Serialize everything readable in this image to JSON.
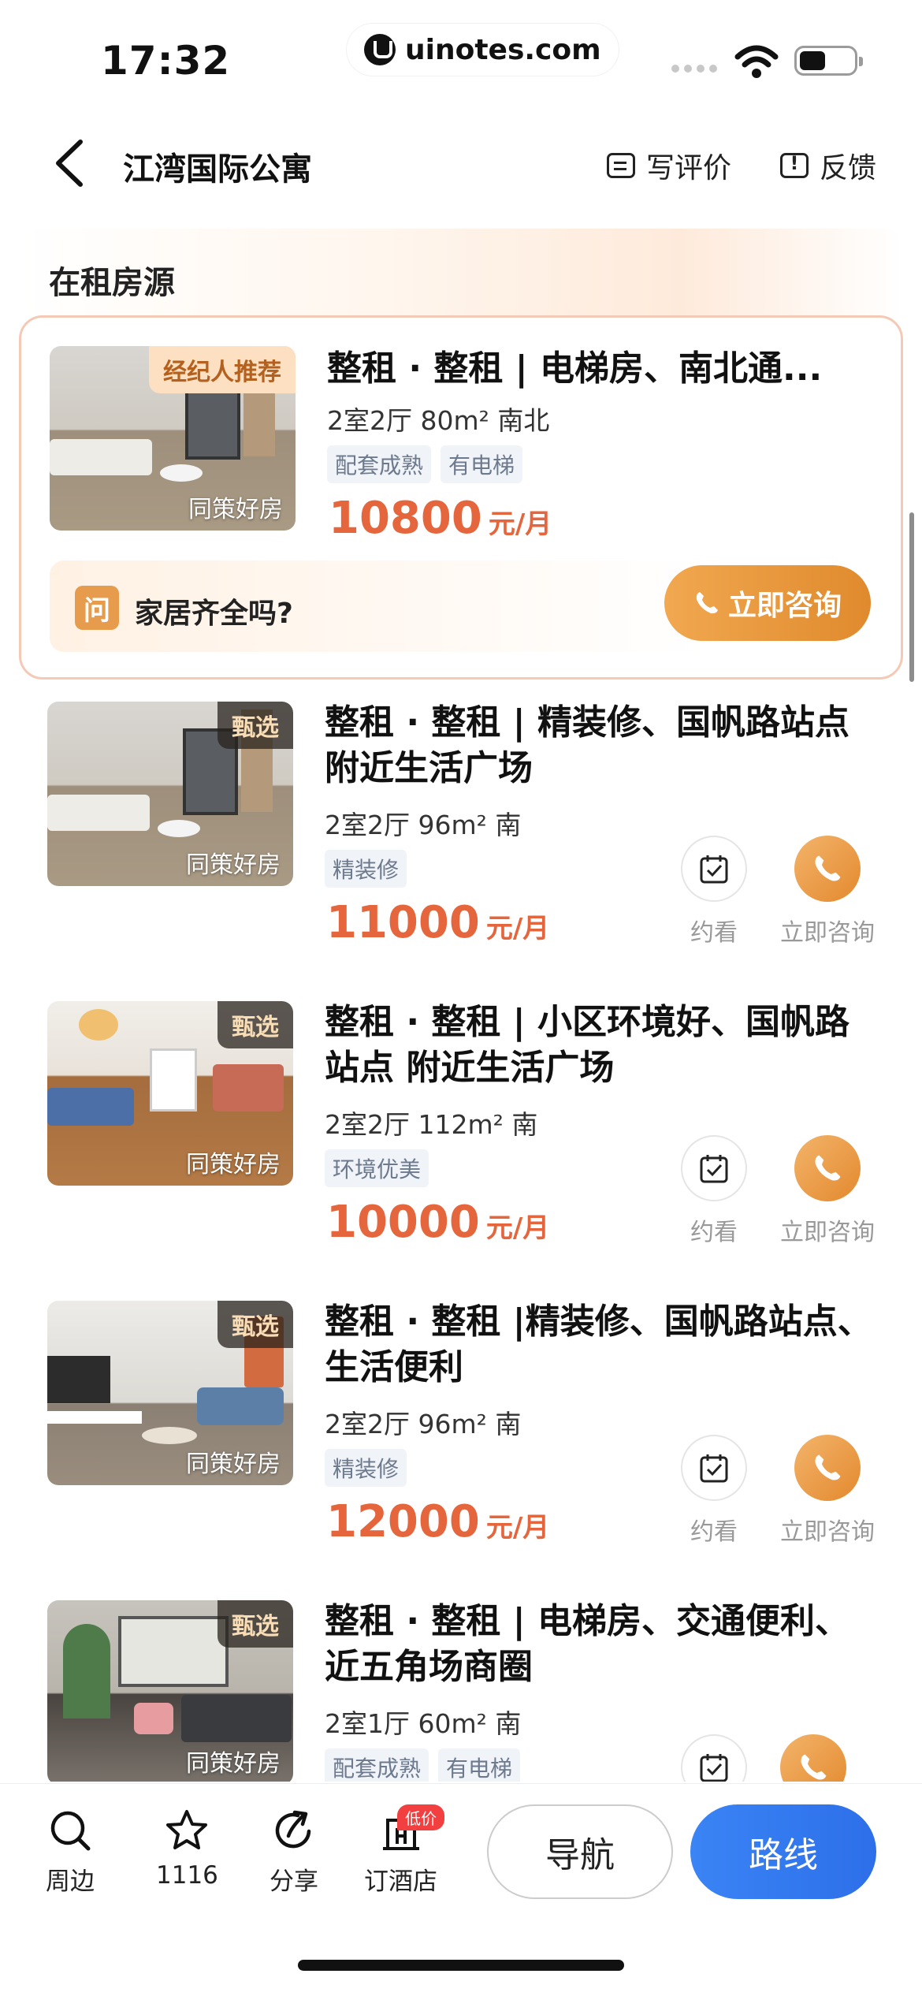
{
  "status": {
    "time": "17:32",
    "url": "uinotes.com"
  },
  "header": {
    "title": "江湾国际公寓",
    "write_review": "写评价",
    "feedback": "反馈"
  },
  "section_title": "在租房源",
  "featured": {
    "badge": "经纪人推荐",
    "watermark": "同策好房",
    "title": "整租 · 整租 | 电梯房、南北通...",
    "spec": "2室2厅  80m²  南北",
    "chips": [
      "配套成熟",
      "有电梯"
    ],
    "price": "10800",
    "unit": "元/月",
    "question_badge": "问",
    "question": "家居齐全吗?",
    "consult": "立即咨询"
  },
  "listings": [
    {
      "badge": "甄选",
      "watermark": "同策好房",
      "title": "整租 · 整租 | 精装修、国帆路站点 附近生活广场",
      "spec": "2室2厅  96m²  南",
      "chip": "精装修",
      "price": "11000",
      "unit": "元/月",
      "view": "约看",
      "consult": "立即咨询"
    },
    {
      "badge": "甄选",
      "watermark": "同策好房",
      "title": "整租 · 整租 | 小区环境好、国帆路站点 附近生活广场",
      "spec": "2室2厅  112m²  南",
      "chip": "环境优美",
      "price": "10000",
      "unit": "元/月",
      "view": "约看",
      "consult": "立即咨询"
    },
    {
      "badge": "甄选",
      "watermark": "同策好房",
      "title": "整租 · 整租 |精装修、国帆路站点、生活便利",
      "spec": "2室2厅  96m²  南",
      "chip": "精装修",
      "price": "12000",
      "unit": "元/月",
      "view": "约看",
      "consult": "立即咨询"
    },
    {
      "badge": "甄选",
      "watermark": "同策好房",
      "title": "整租 · 整租 | 电梯房、交通便利、近五角场商圈",
      "spec": "2室1厅  60m²  南",
      "chips": [
        "配套成熟",
        "有电梯"
      ]
    }
  ],
  "bottom": {
    "nearby": "周边",
    "favorites": "1116",
    "share": "分享",
    "hotel": "订酒店",
    "hotel_badge": "低价",
    "navigate": "导航",
    "route": "路线"
  },
  "colors": {
    "price": "#e5663d",
    "accent_orange": "#e3892e",
    "route_blue": "#2d6fe9"
  }
}
